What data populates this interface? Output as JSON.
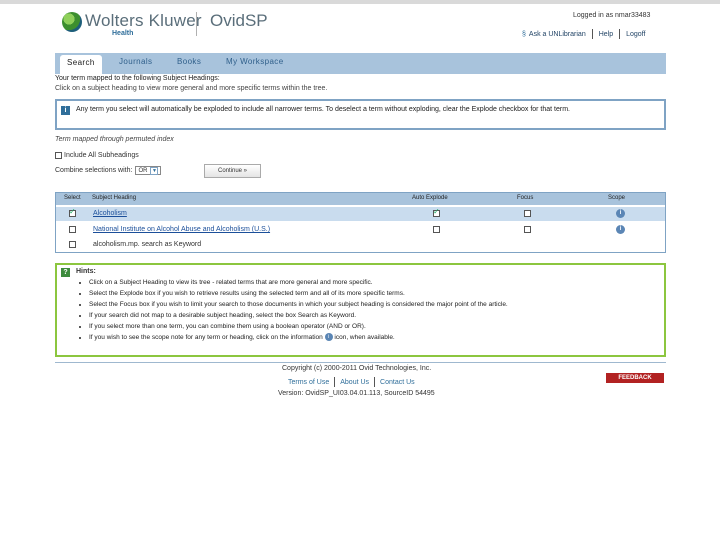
{
  "header": {
    "brand": "Wolters Kluwer",
    "sub_brand": "Health",
    "product": "OvidSP",
    "logged_in": "Logged in as nmar33483",
    "links": [
      "Ask a UNLibrarian",
      "Help",
      "Logoff"
    ]
  },
  "tabs": [
    "Search",
    "Journals",
    "Books",
    "My Workspace"
  ],
  "main": {
    "mapped_heading": "Your term mapped to the following Subject Headings:",
    "mapped_instructions": "Click on a subject heading to view more general and more specific terms within the tree.",
    "info_text": "Any term you select will automatically be exploded to include all narrower terms. To deselect a term without exploding, clear the Explode checkbox for that term.",
    "via_index": "Term mapped through permuted index",
    "include_all": "Include All Subheadings",
    "combine_label": "Combine selections with:",
    "combine_value": "OR",
    "continue_label": "Continue »"
  },
  "table": {
    "headers": [
      "Select",
      "Subject Heading",
      "Auto Explode",
      "Focus",
      "Scope"
    ],
    "rows": [
      {
        "heading": "Alcoholism",
        "select": true,
        "explode": true,
        "focus": false,
        "highlight": true
      },
      {
        "heading": "National Institute on Alcohol Abuse and Alcoholism (U.S.)",
        "select": false,
        "explode": false,
        "focus": false,
        "highlight": false
      },
      {
        "heading": "alcoholism.mp. search as Keyword",
        "select": false,
        "explode": null,
        "focus": null,
        "highlight": false
      }
    ]
  },
  "hints": {
    "title": "Hints:",
    "items": [
      "Click on a Subject Heading to view its tree - related terms that are more general and more specific.",
      "Select the Explode box if you wish to retrieve results using the selected term and all of its more specific terms.",
      "Select the Focus box if you wish to limit your search to those documents in which your subject heading is considered the major point of the article.",
      "If your search did not map to a desirable subject heading, select the box Search as Keyword.",
      "If you select more than one term, you can combine them using a boolean operator (AND or OR).",
      "If you wish to see the scope note for any term or heading, click on the information",
      "icon, when available."
    ]
  },
  "footer": {
    "copyright": "Copyright (c) 2000-2011 Ovid Technologies, Inc.",
    "links": [
      "Terms of Use",
      "About Us",
      "Contact Us"
    ],
    "version": "Version: OvidSP_UI03.04.01.113, SourceID 54495",
    "feedback": "FEEDBACK"
  },
  "colors": {
    "tabbar": "#a8c3dc",
    "hints_border": "#8cc63f",
    "feedback": "#b22222"
  }
}
